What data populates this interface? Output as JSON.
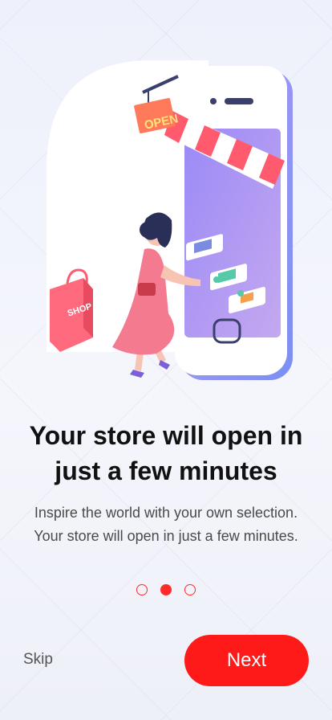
{
  "onboarding": {
    "title": "Your store will open in just a few minutes",
    "description": "Inspire the world with your own selection. Your store will open in just a few minutes.",
    "page_indicator": {
      "total": 3,
      "current": 2
    },
    "skip_label": "Skip",
    "next_label": "Next"
  },
  "illustration": {
    "open_sign_text": "OPEN",
    "bag_text": "SHOP"
  },
  "colors": {
    "accent": "#ff1a1a",
    "phone_gradient_start": "#8b7cf6",
    "phone_gradient_end": "#b79bf0",
    "awning_red": "#ff5a6e",
    "dress_pink": "#f47b8f"
  }
}
